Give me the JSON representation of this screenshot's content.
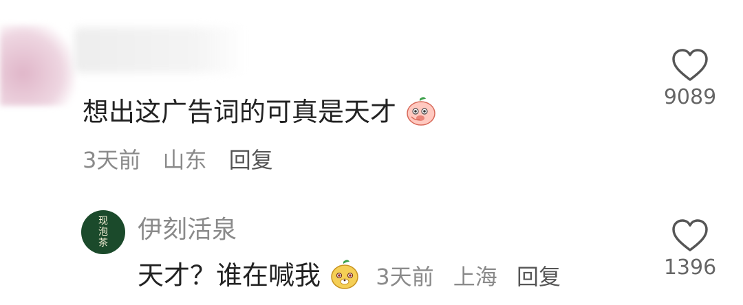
{
  "comment": {
    "text": "想出这广告词的可真是天才",
    "time": "3天前",
    "location": "山东",
    "reply_label": "回复",
    "likes": "9089",
    "emoji": "peach-face-emoji"
  },
  "reply": {
    "avatar_text": [
      "现",
      "泡",
      "茶"
    ],
    "author": "伊刻活泉",
    "text": "天才？谁在喊我",
    "time": "3天前",
    "location": "上海",
    "reply_label": "回复",
    "likes": "1396",
    "emoji": "cute-face-emoji"
  },
  "colors": {
    "text": "#222222",
    "meta": "#8a8a8a",
    "avatar_bg": "#1b4a2b"
  }
}
